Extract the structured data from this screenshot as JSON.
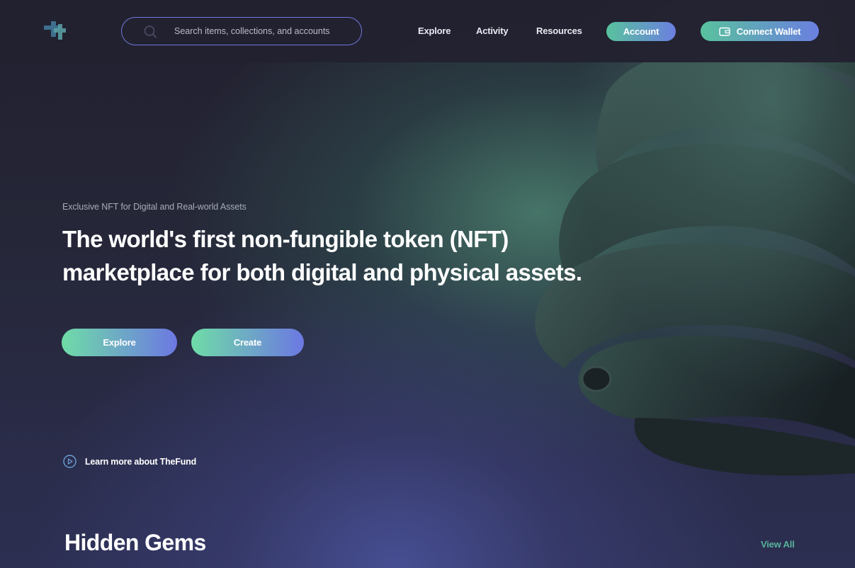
{
  "header": {
    "search_placeholder": "Search items, collections, and accounts",
    "nav": [
      {
        "label": "Explore"
      },
      {
        "label": "Activity"
      },
      {
        "label": "Resources"
      }
    ],
    "account_label": "Account",
    "connect_wallet_label": "Connect Wallet"
  },
  "hero": {
    "eyebrow": "Exclusive NFT for Digital and Real-world Assets",
    "headline_line1": "The world's first non-fungible token (NFT)",
    "headline_line2": "marketplace for both digital and physical assets.",
    "explore_label": "Explore",
    "create_label": "Create",
    "learn_more_label": "Learn more about TheFund"
  },
  "hidden_gems": {
    "title": "Hidden Gems",
    "view_all_label": "View All"
  },
  "colors": {
    "accent_green": "#58c29d",
    "accent_blue": "#6b7fe0",
    "link_green": "#57b39a",
    "background": "#1d1d2e"
  },
  "icons": [
    "logo-icon",
    "search-icon",
    "wallet-icon",
    "play-icon"
  ]
}
